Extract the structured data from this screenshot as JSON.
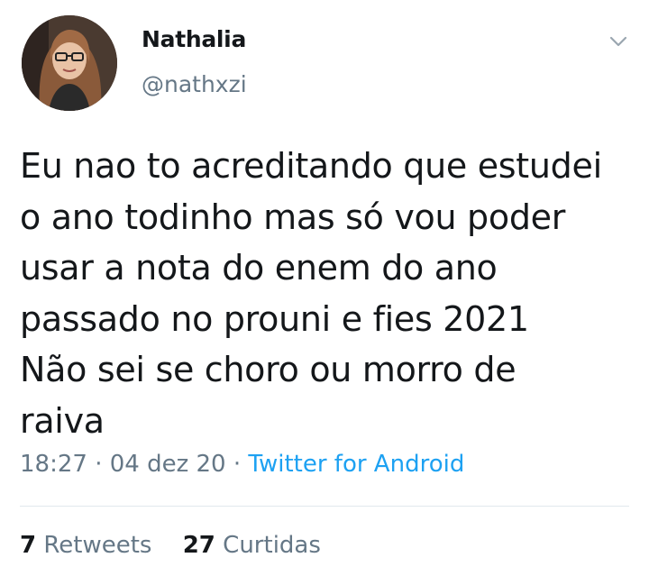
{
  "author": {
    "display_name": "Nathalia",
    "handle": "@nathxzi"
  },
  "tweet": {
    "text": "Eu nao to acreditando que estudei\no ano todinho mas só vou poder\nusar a nota do enem do ano\npassado no prouni e fies 2021\nNão sei se choro ou morro de\nraiva",
    "time": "18:27",
    "separator": "·",
    "date": "04 dez 20",
    "source": "Twitter for Android"
  },
  "stats": {
    "retweets_count": "7",
    "retweets_label": "Retweets",
    "likes_count": "27",
    "likes_label": "Curtidas"
  },
  "icons": {
    "more": "chevron-down-icon"
  },
  "colors": {
    "text": "#14171a",
    "secondary": "#657786",
    "link": "#1da1f2",
    "divider": "#e1e8ed"
  }
}
